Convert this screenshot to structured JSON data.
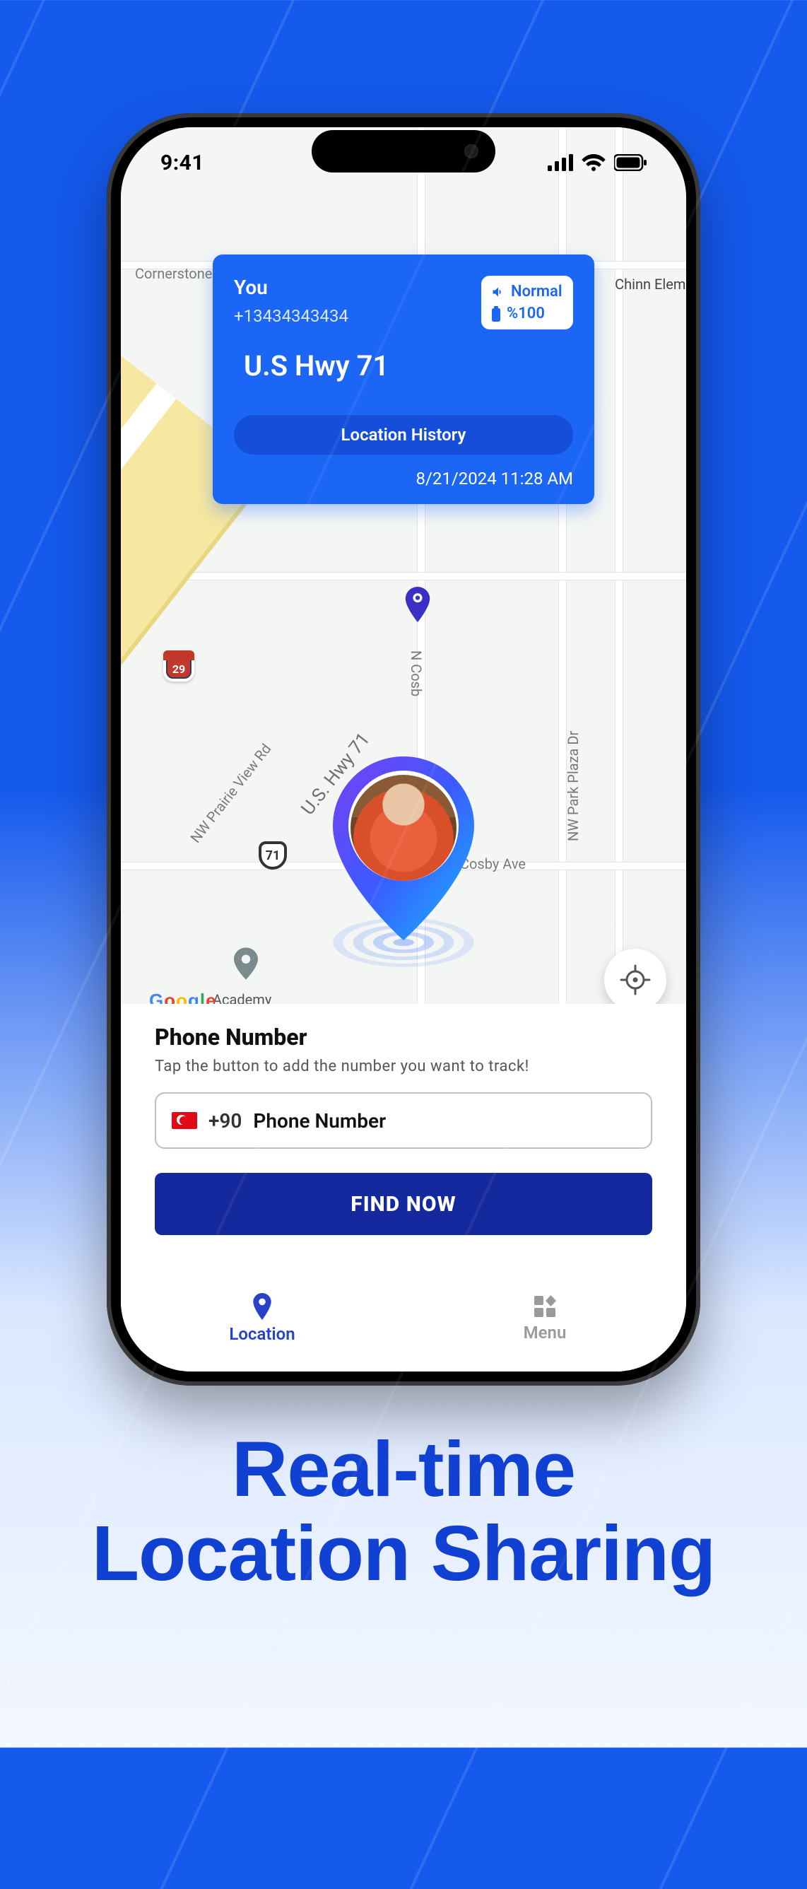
{
  "statusbar": {
    "time": "9:41"
  },
  "map": {
    "labels": {
      "cornerstone": "Cornerstone",
      "chinn": "Chinn Eleme",
      "prairie": "NW Prairie View Rd",
      "cosby_n": "N Cosb",
      "cosby_ave": "Cosby Ave",
      "park_plaza": "NW Park Plaza Dr",
      "academy": "Academy",
      "hwy": "U.S. Hwy 71",
      "interstate": "29",
      "route": "71"
    }
  },
  "card": {
    "you": "You",
    "phone": "+13434343434",
    "sound_mode": "Normal",
    "battery": "%100",
    "address": "U.S Hwy 71",
    "history_btn": "Location History",
    "timestamp": "8/21/2024 11:28 AM"
  },
  "panel": {
    "title": "Phone Number",
    "hint": "Tap the button to add the number you want to track!",
    "country_code": "+90",
    "placeholder": "Phone Number",
    "find_btn": "FIND NOW"
  },
  "nav": {
    "location": "Location",
    "menu": "Menu"
  },
  "caption": {
    "line1": "Real-time",
    "line2": "Location Sharing"
  }
}
